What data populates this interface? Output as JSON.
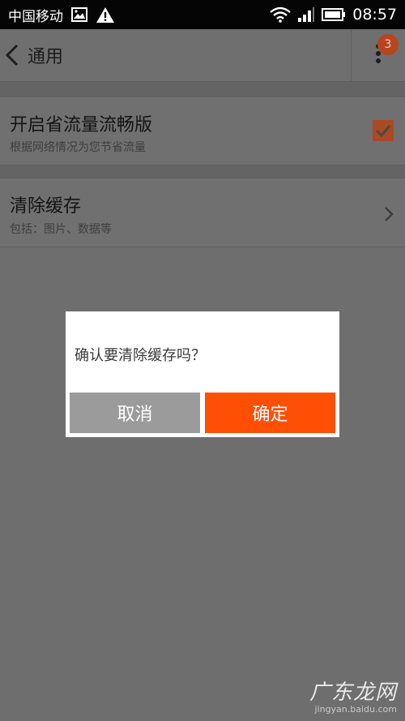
{
  "status_bar": {
    "carrier": "中国移动",
    "time": "08:57",
    "icons": [
      "image-icon",
      "warning-icon",
      "wifi-icon",
      "signal-icon",
      "battery-icon"
    ]
  },
  "action_bar": {
    "title": "通用",
    "notification_count": "3",
    "icons": [
      "back-arrow-icon",
      "overflow-menu-icon"
    ]
  },
  "settings": {
    "data_saver": {
      "title": "开启省流量流畅版",
      "subtitle": "根据网络情况为您节省流量",
      "checked": true
    },
    "clear_cache": {
      "title": "清除缓存",
      "subtitle": "包括：图片、数据等"
    }
  },
  "dialog": {
    "message": "确认要清除缓存吗？",
    "cancel_label": "取消",
    "confirm_label": "确定"
  },
  "watermark": {
    "main": "广东龙网",
    "sub": "jingyan.baidu.com"
  },
  "colors": {
    "accent": "#ff4f05",
    "cancel": "#9b9b9b",
    "dim_background": "#6e6e6e",
    "status_bar": "#050505"
  }
}
